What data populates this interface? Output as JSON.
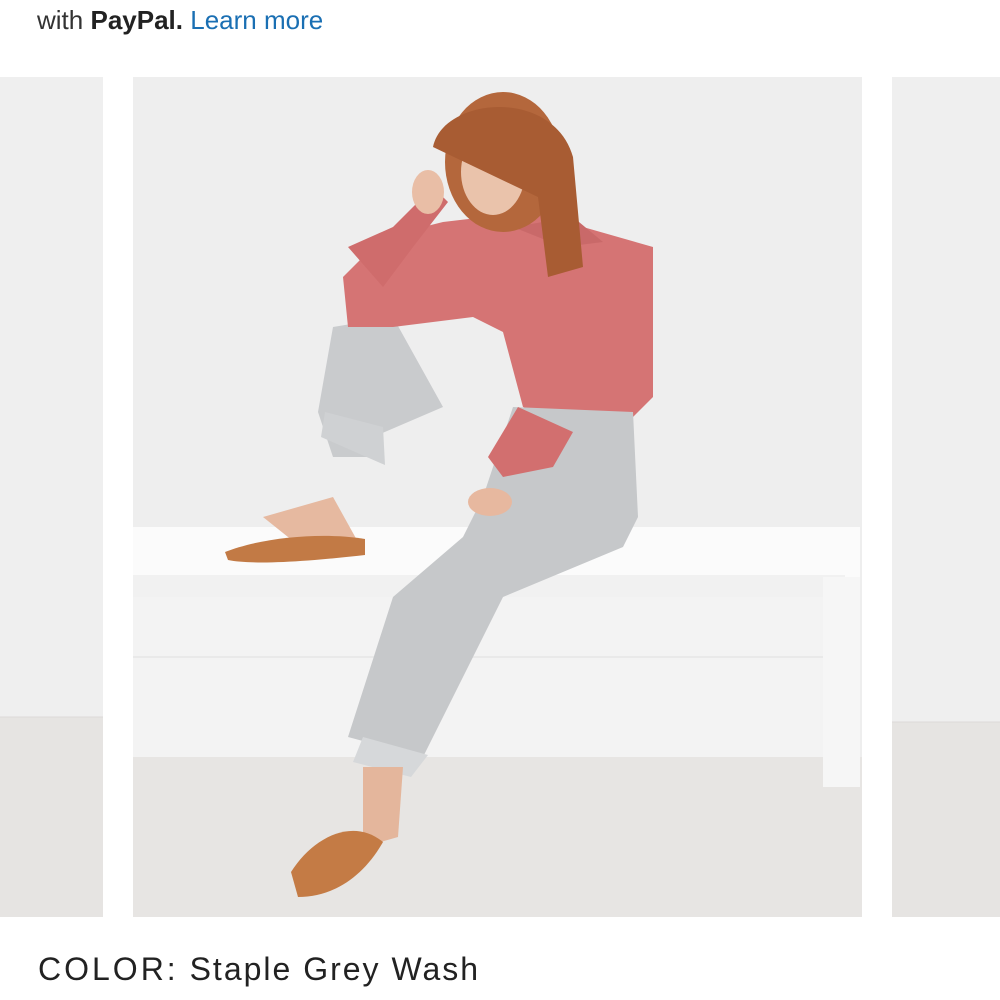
{
  "payment": {
    "prefix": "with",
    "brand": "PayPal.",
    "link_label": "Learn more"
  },
  "carousel": {
    "background_color": "#efefef",
    "floor_color": "#e7e5e3"
  },
  "product": {
    "color_label": "COLOR:",
    "color_value": "Staple Grey Wash"
  }
}
